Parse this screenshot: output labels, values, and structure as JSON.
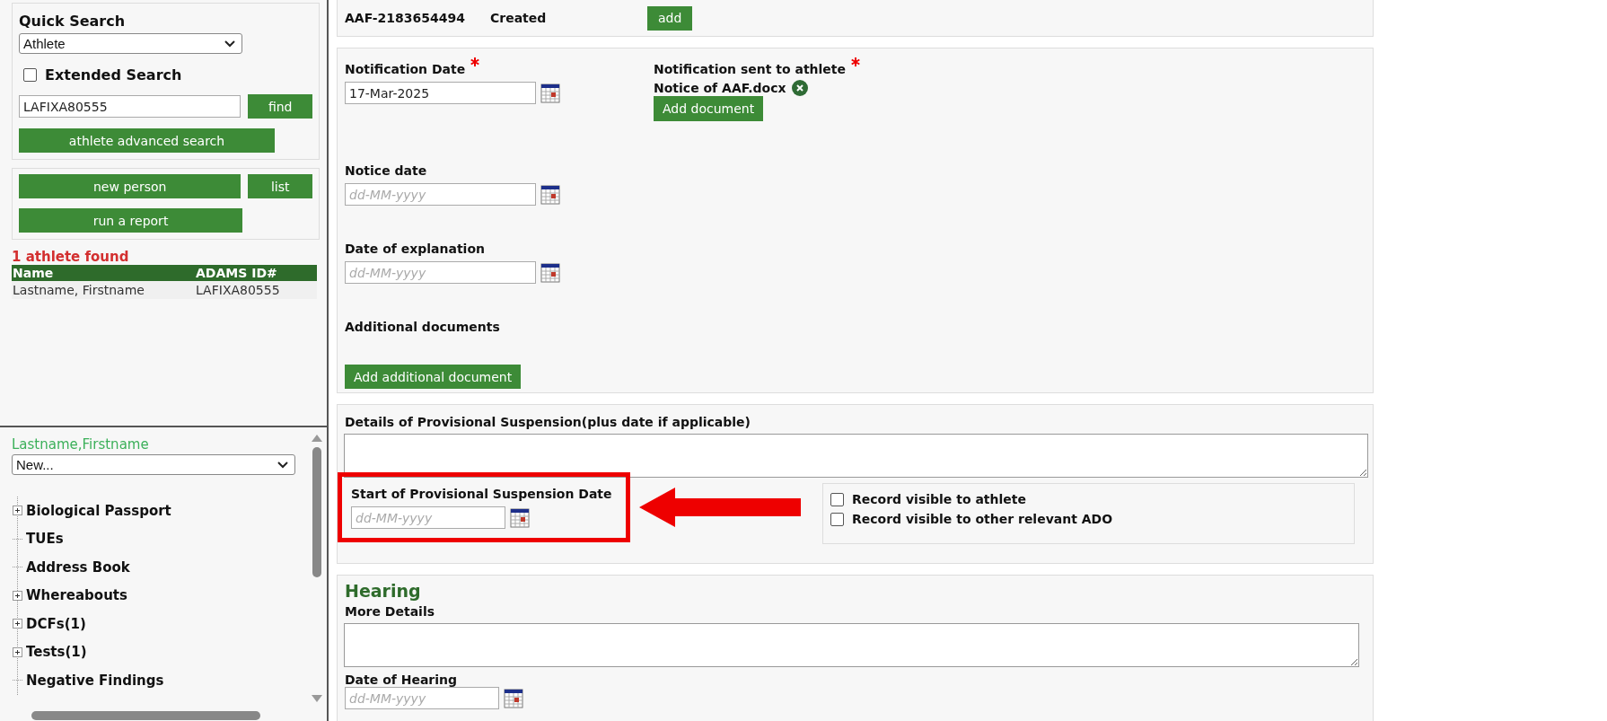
{
  "sidebar": {
    "quick_search": {
      "title": "Quick Search",
      "type_select": "Athlete",
      "extended_search": {
        "label": "Extended Search",
        "checked": false
      },
      "search_value": "LAFIXA80555",
      "find_button": "find",
      "advanced_button": "athlete advanced search"
    },
    "actions": {
      "new_person": "new person",
      "list": "list",
      "report": "run a report"
    },
    "results": {
      "count_text": "1 athlete found",
      "columns": [
        "Name",
        "ADAMS ID#"
      ],
      "rows": [
        [
          "Lastname, Firstname",
          "LAFIXA80555"
        ]
      ]
    },
    "person": {
      "name": "Lastname,Firstname",
      "action_select": "New...",
      "tree": [
        {
          "label": "Biological Passport",
          "expandable": true
        },
        {
          "label": "TUEs",
          "expandable": false
        },
        {
          "label": "Address Book",
          "expandable": false
        },
        {
          "label": "Whereabouts",
          "expandable": true
        },
        {
          "label": "DCFs(1)",
          "expandable": true
        },
        {
          "label": "Tests(1)",
          "expandable": true
        },
        {
          "label": "Negative Findings",
          "expandable": false
        }
      ]
    }
  },
  "record": {
    "id": "AAF-2183654494",
    "status": "Created",
    "add_button": "add"
  },
  "notification": {
    "date_label": "Notification Date",
    "date_required": true,
    "date_value": "17-Mar-2025",
    "sent_label": "Notification sent to athlete",
    "sent_required": true,
    "document": "Notice of AAF.docx",
    "add_document_button": "Add document",
    "notice_date_label": "Notice date",
    "notice_date_placeholder": "dd-MM-yyyy",
    "explanation_label": "Date of explanation",
    "explanation_placeholder": "dd-MM-yyyy",
    "additional_label": "Additional documents",
    "additional_button": "Add additional document"
  },
  "suspension": {
    "details_label": "Details of Provisional Suspension(plus date if applicable)",
    "start_label": "Start of Provisional Suspension Date",
    "start_placeholder": "dd-MM-yyyy",
    "highlighted": true,
    "checkboxes": [
      {
        "label": "Record visible to athlete",
        "checked": false
      },
      {
        "label": "Record visible to other relevant ADO",
        "checked": false
      }
    ]
  },
  "hearing": {
    "title": "Hearing",
    "details_label": "More Details",
    "date_label": "Date of Hearing",
    "date_placeholder": "dd-MM-yyyy"
  }
}
